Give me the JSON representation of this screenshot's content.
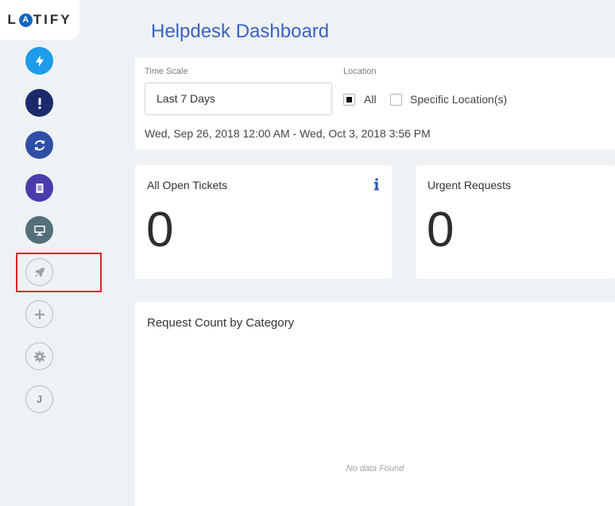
{
  "logo": {
    "pre": "L",
    "mark": "A",
    "post": "TIFY"
  },
  "sidebar": {
    "items": [
      {
        "name": "quick-actions",
        "icon": "lightning-icon",
        "color": "#1e9be9"
      },
      {
        "name": "alerts",
        "icon": "exclamation-icon",
        "color": "#1b2a6b"
      },
      {
        "name": "sync",
        "icon": "refresh-icon",
        "color": "#2f4fa6"
      },
      {
        "name": "knowledge-base",
        "icon": "book-icon",
        "color": "#4a3cad"
      },
      {
        "name": "devices",
        "icon": "monitor-icon",
        "color": "#546e7a"
      },
      {
        "name": "deploy",
        "icon": "rocket-icon",
        "color": "#9aa0a6"
      },
      {
        "name": "add",
        "icon": "plus-icon",
        "color": "#9aa0a6"
      },
      {
        "name": "settings",
        "icon": "gear-icon",
        "color": "#9aa0a6"
      },
      {
        "name": "user",
        "icon": "avatar-initial",
        "initial": "J",
        "color": "#9aa0a6"
      }
    ]
  },
  "page": {
    "title": "Helpdesk Dashboard"
  },
  "filters": {
    "time_scale_label": "Time Scale",
    "time_scale_value": "Last 7 Days",
    "location_label": "Location",
    "location_all": "All",
    "location_all_checked": true,
    "location_specific": "Specific Location(s)",
    "location_specific_checked": false,
    "date_range": "Wed, Sep 26, 2018 12:00 AM - Wed, Oct 3, 2018 3:56 PM"
  },
  "stats": {
    "open_tickets": {
      "title": "All Open Tickets",
      "value": "0"
    },
    "urgent_requests": {
      "title": "Urgent Requests",
      "value": "0"
    }
  },
  "chart": {
    "title": "Request Count by Category",
    "empty_message": "No data Found"
  },
  "colors": {
    "accent": "#3a62c4",
    "highlight": "#e0202a"
  }
}
